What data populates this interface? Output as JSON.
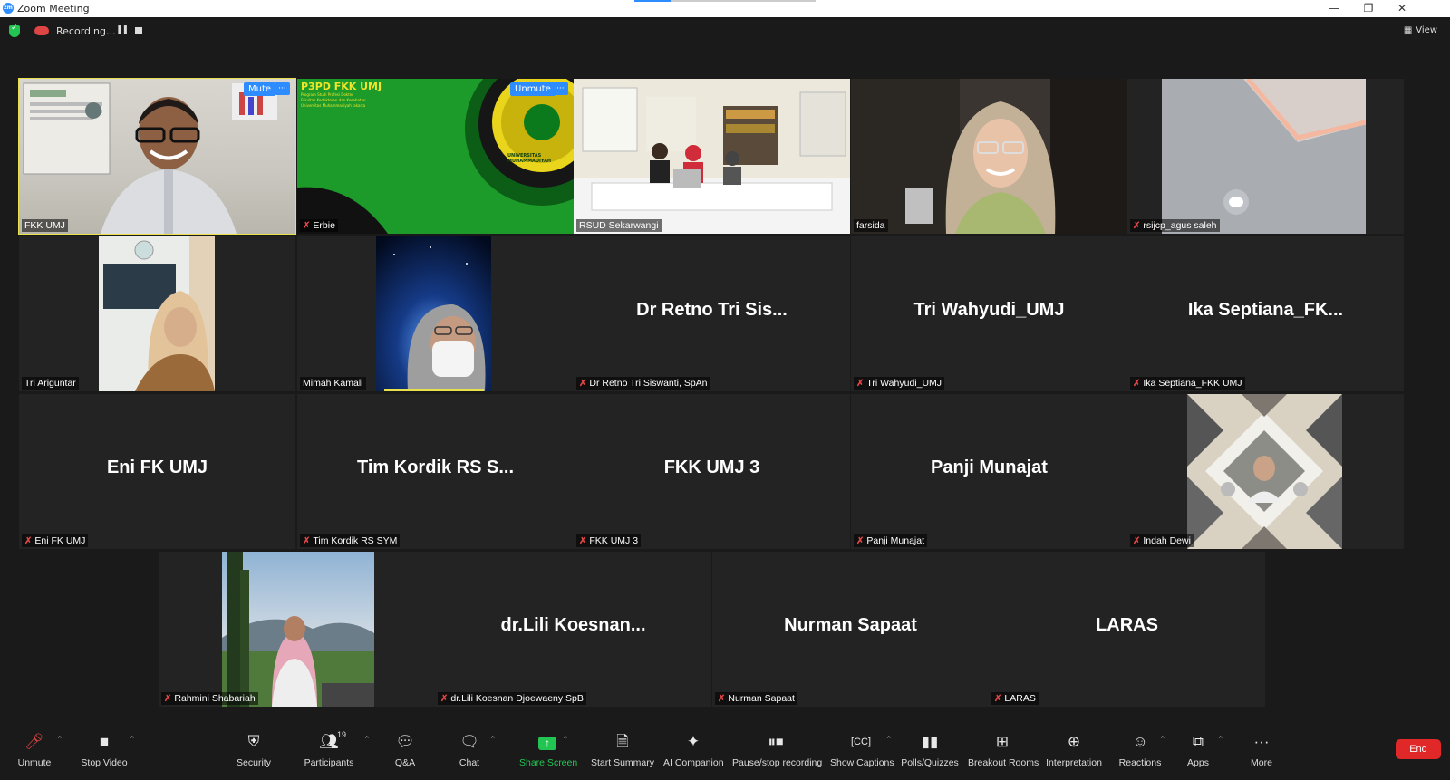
{
  "window": {
    "title": "Zoom Meeting",
    "controls": {
      "minimize": "—",
      "restore": "❐",
      "close": "✕"
    }
  },
  "topbar": {
    "recording_label": "Recording...",
    "view_label": "View"
  },
  "tiles": [
    {
      "name": "FKK UMJ",
      "big": "",
      "muted": false,
      "active": true,
      "mute_btn": "Mute",
      "more": "···"
    },
    {
      "name": "Erbie",
      "big": "",
      "muted": true,
      "unmute_btn": "Unmute",
      "more": "···",
      "slide_title": "P3PD FKK UMJ",
      "slide_lines": [
        "Program Studi Profesi Dokter",
        "Fakultas Kedokteran dan Kesehatan",
        "Universitas Muhammadiyah Jakarta"
      ],
      "seal_text": "UNIVERSITAS MUHAMMADIYAH"
    },
    {
      "name": "RSUD Sekarwangi",
      "big": "",
      "muted": false
    },
    {
      "name": "farsida",
      "big": "",
      "muted": false
    },
    {
      "name": "rsijcp_agus saleh",
      "big": "",
      "muted": true
    },
    {
      "name": "Tri Ariguntar",
      "big": "",
      "muted": false
    },
    {
      "name": "Mimah Kamali",
      "big": "",
      "muted": false
    },
    {
      "name": "Dr Retno Tri Siswanti, SpAn",
      "big": "Dr Retno Tri Sis...",
      "muted": true
    },
    {
      "name": "Tri Wahyudi_UMJ",
      "big": "Tri Wahyudi_UMJ",
      "muted": true
    },
    {
      "name": "Ika Septiana_FKK UMJ",
      "big": "Ika  Septiana_FK...",
      "muted": true
    },
    {
      "name": "Eni FK UMJ",
      "big": "Eni FK UMJ",
      "muted": true
    },
    {
      "name": "Tim Kordik RS SYM",
      "big": "Tim Kordik RS S...",
      "muted": true
    },
    {
      "name": "FKK UMJ 3",
      "big": "FKK UMJ 3",
      "muted": true
    },
    {
      "name": "Panji Munajat",
      "big": "Panji Munajat",
      "muted": true
    },
    {
      "name": "Indah Dewi",
      "big": "",
      "muted": true
    },
    {
      "name": "Rahmini Shabariah",
      "big": "",
      "muted": true
    },
    {
      "name": "dr.Lili Koesnan Djoewaeny SpB",
      "big": "dr.Lili  Koesnan...",
      "muted": true
    },
    {
      "name": "Nurman Sapaat",
      "big": "Nurman Sapaat",
      "muted": true
    },
    {
      "name": "LARAS",
      "big": "LARAS",
      "muted": true
    }
  ],
  "toolbar": {
    "unmute": "Unmute",
    "stop_video": "Stop Video",
    "security": "Security",
    "participants": "Participants",
    "participants_count": "19",
    "qa": "Q&A",
    "chat": "Chat",
    "share_screen": "Share Screen",
    "start_summary": "Start Summary",
    "ai_companion": "AI Companion",
    "pause_recording": "Pause/stop recording",
    "show_captions": "Show Captions",
    "polls": "Polls/Quizzes",
    "breakout": "Breakout Rooms",
    "interpretation": "Interpretation",
    "reactions": "Reactions",
    "apps": "Apps",
    "more": "More",
    "end": "End"
  },
  "colors": {
    "active_border": "#e8e14b",
    "zoom_blue": "#2d8cff",
    "end_red": "#e02828",
    "muted_red": "#e04545",
    "tile_bg": "#232323"
  }
}
